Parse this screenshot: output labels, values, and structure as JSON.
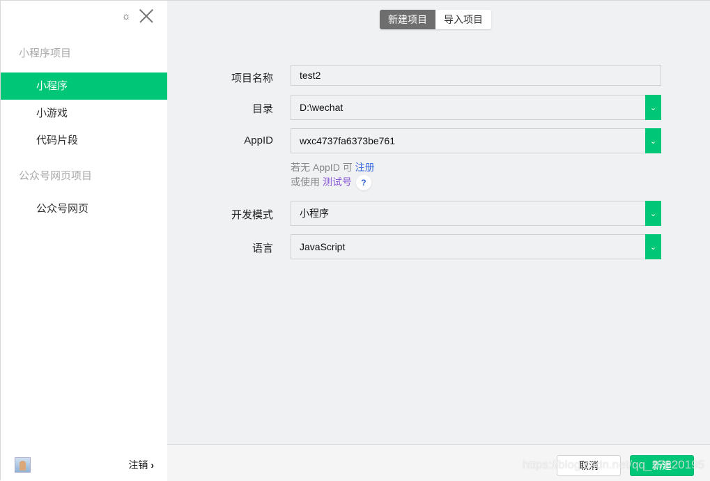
{
  "sidebar": {
    "section1": "小程序项目",
    "items1": [
      "小程序",
      "小游戏",
      "代码片段"
    ],
    "section2": "公众号网页项目",
    "items2": [
      "公众号网页"
    ],
    "logout": "注销",
    "logout_arrow": "›"
  },
  "tabs": [
    "新建项目",
    "导入项目"
  ],
  "form": {
    "name_label": "项目名称",
    "name_value": "test2",
    "dir_label": "目录",
    "dir_value": "D:\\wechat",
    "appid_label": "AppID",
    "appid_value": "wxc4737fa6373be761",
    "hint1_prefix": "若无 AppID 可",
    "hint1_link": "注册",
    "hint2_prefix": "或使用",
    "hint2_link": "测试号",
    "help": "?",
    "mode_label": "开发模式",
    "mode_value": "小程序",
    "lang_label": "语言",
    "lang_value": "JavaScript"
  },
  "footer": {
    "cancel": "取消",
    "create": "新建"
  },
  "watermark": "https://blog.csdn.net/qq_27820195",
  "colors": {
    "accent": "#00c777",
    "link": "#3a6be0"
  }
}
